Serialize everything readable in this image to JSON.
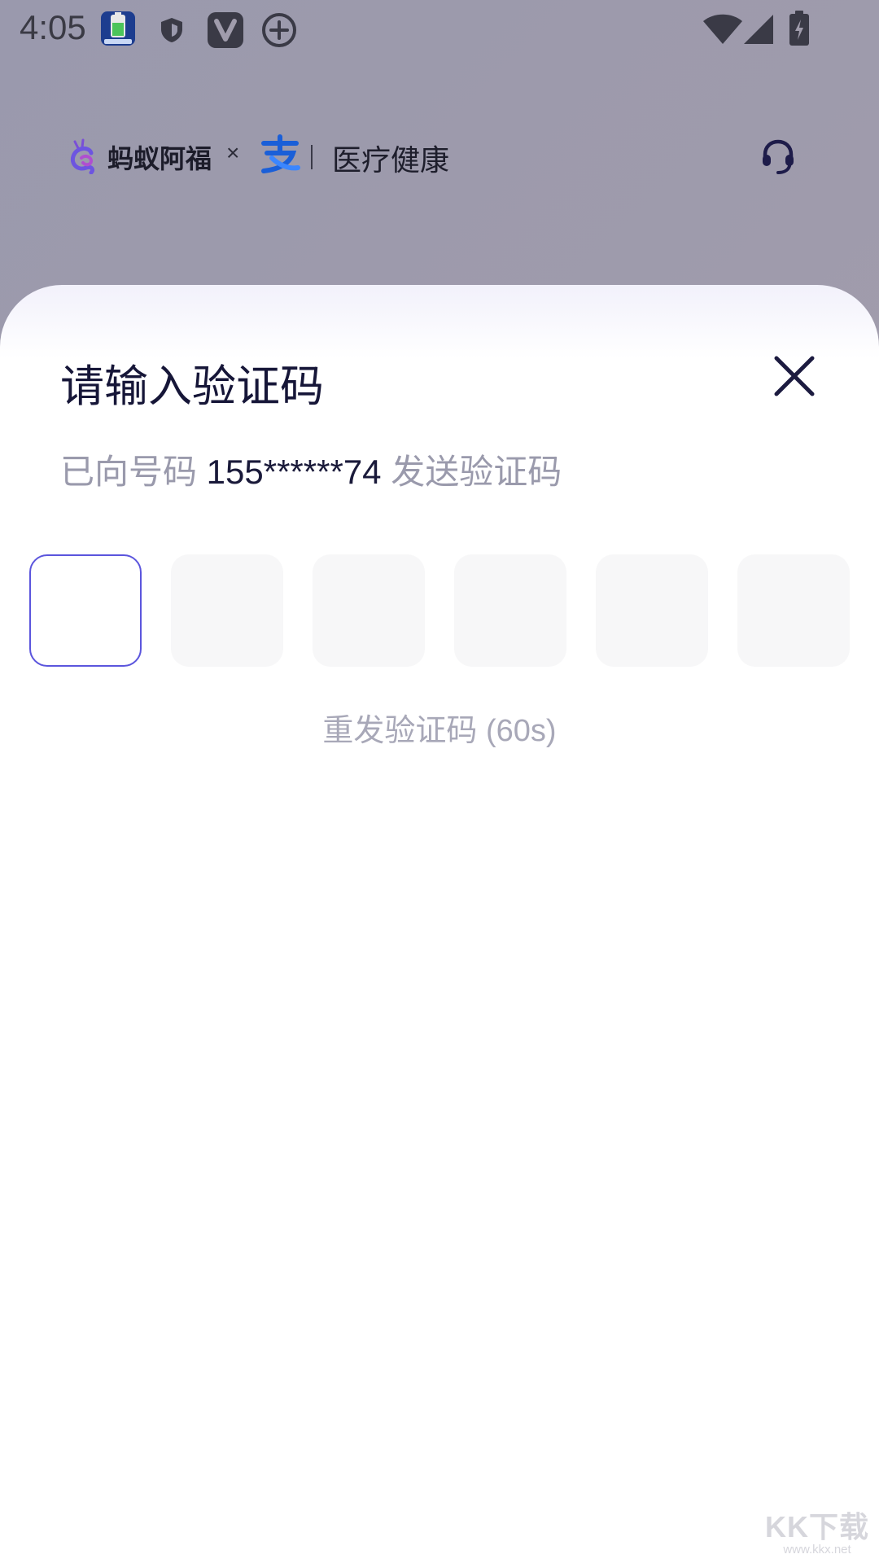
{
  "status_bar": {
    "time": "4:05",
    "left_icons": [
      "battery-app-icon",
      "shield-icon",
      "v-app-icon",
      "add-circle-icon"
    ],
    "right_icons": [
      "wifi-icon",
      "signal-icon",
      "battery-charging-icon"
    ]
  },
  "header": {
    "brand_name": "蚂蚁阿福",
    "cross": "×",
    "section_title": "医疗健康",
    "service_icon": "headset-icon",
    "colors": {
      "brand_purple": "#7a4fd6",
      "alipay_blue": "#1677ff"
    }
  },
  "sheet": {
    "title": "请输入验证码",
    "close_icon": "close-icon",
    "sent_prefix": "已向号码 ",
    "phone": "155******74",
    "sent_suffix": " 发送验证码",
    "code_boxes": [
      "",
      "",
      "",
      "",
      "",
      ""
    ],
    "resend": "重发验证码 (60s)",
    "colors": {
      "active_border": "#5b55dd",
      "box_fill": "#f7f7f8"
    }
  },
  "watermark": {
    "main": "KK下载",
    "sub": "www.kkx.net"
  }
}
